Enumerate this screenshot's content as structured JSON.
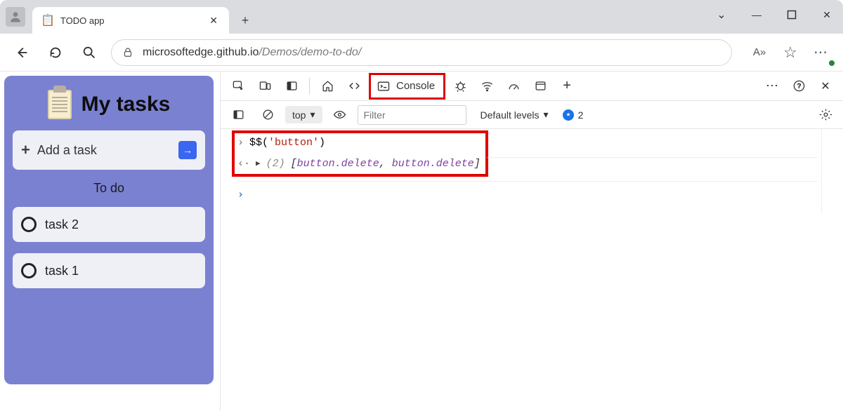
{
  "window": {
    "tab_title": "TODO app",
    "tab_close_glyph": "✕",
    "new_tab_glyph": "+",
    "chevron_glyph": "⌄",
    "minimize_glyph": "—",
    "maximize_glyph": "▢",
    "close_glyph": "✕"
  },
  "address": {
    "host": "microsoftedge.github.io",
    "path": "/Demos/demo-to-do/",
    "read_aloud_label": "A»",
    "star_glyph": "☆",
    "more_glyph": "⋯"
  },
  "app": {
    "title": "My tasks",
    "add_placeholder": "Add a task",
    "plus_glyph": "+",
    "go_arrow": "→",
    "section_label": "To do",
    "tasks": [
      "task 2",
      "task 1"
    ]
  },
  "devtools": {
    "tabs": {
      "console_label": "Console",
      "plus_glyph": "+",
      "more_glyph": "⋯",
      "close_glyph": "✕"
    },
    "toolbar": {
      "scope_label": "top",
      "scope_caret": "▾",
      "filter_placeholder": "Filter",
      "levels_label": "Default levels",
      "levels_caret": "▾",
      "issue_count": "2"
    },
    "console": {
      "prompt_glyph": "›",
      "output_glyph": "‹·",
      "expand_glyph": "▶",
      "input": "$$('button')",
      "input_prefix": "$$(",
      "input_string": "'button'",
      "input_suffix": ")",
      "out_count": "(2)",
      "bracket_open": "[",
      "bracket_close": "]",
      "item1": "button.delete",
      "comma": ",",
      "item2": "button.delete",
      "blue_caret": "›"
    }
  }
}
